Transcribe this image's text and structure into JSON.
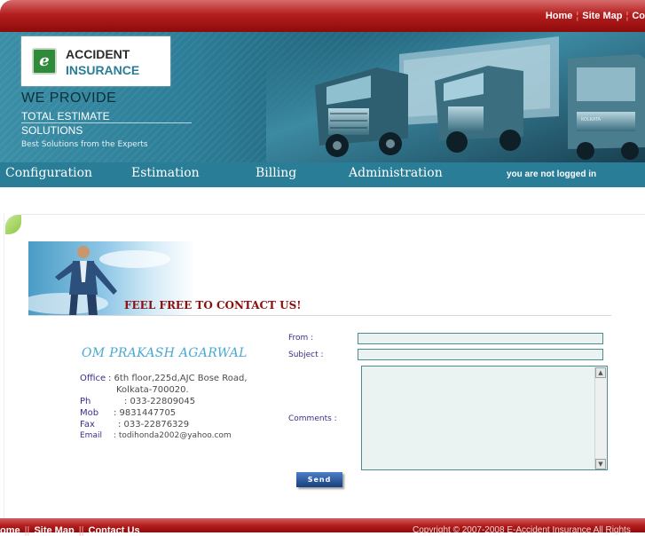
{
  "top_nav": {
    "home": "Home",
    "site_map": "Site Map",
    "contact": "Co"
  },
  "banner": {
    "logo_line1": "ACCIDENT",
    "logo_line2": "INSURANCE",
    "logo_letter": "e",
    "tagline1": "WE PROVIDE",
    "tagline2": "TOTAL ESTIMATE",
    "tagline3": "SOLUTIONS",
    "tagline4": "Best Solutions from the Experts"
  },
  "main_nav": {
    "items": [
      "Configuration",
      "Estimation",
      "Billing",
      "Administration"
    ],
    "login_status": "you are not logged in"
  },
  "contact": {
    "heading": "FEEL FREE TO CONTACT US!",
    "name": "OM PRAKASH AGARWAL",
    "office_label": "Office",
    "office_line1": ": 6th floor,225d,AJC Bose Road,",
    "office_line2": "Kolkata-700020.",
    "ph_label": "Ph",
    "ph_value": ": 033-22809045",
    "mob_label": "Mob",
    "mob_value": ": 9831447705",
    "fax_label": "Fax",
    "fax_value": ": 033-22876329",
    "email_label": "Email",
    "email_value": ": todihonda2002@yahoo.com"
  },
  "form": {
    "from_label": "From :",
    "from_value": "",
    "subject_label": "Subject :",
    "subject_value": "",
    "comments_label": "Comments :",
    "comments_value": "",
    "send_label": "Send"
  },
  "footer": {
    "home": "ome",
    "site_map": "Site Map",
    "contact": "Contact Us",
    "copyright": "Copyright © 2007-2008 E-Accident Insurance All Rights"
  },
  "colors": {
    "top_bar": "#b51e1e",
    "nav_bar": "#2a7d97",
    "heading_red": "#8b0f0f",
    "label_purple": "#3f2b8a",
    "name_blue": "#4aa9d0"
  }
}
